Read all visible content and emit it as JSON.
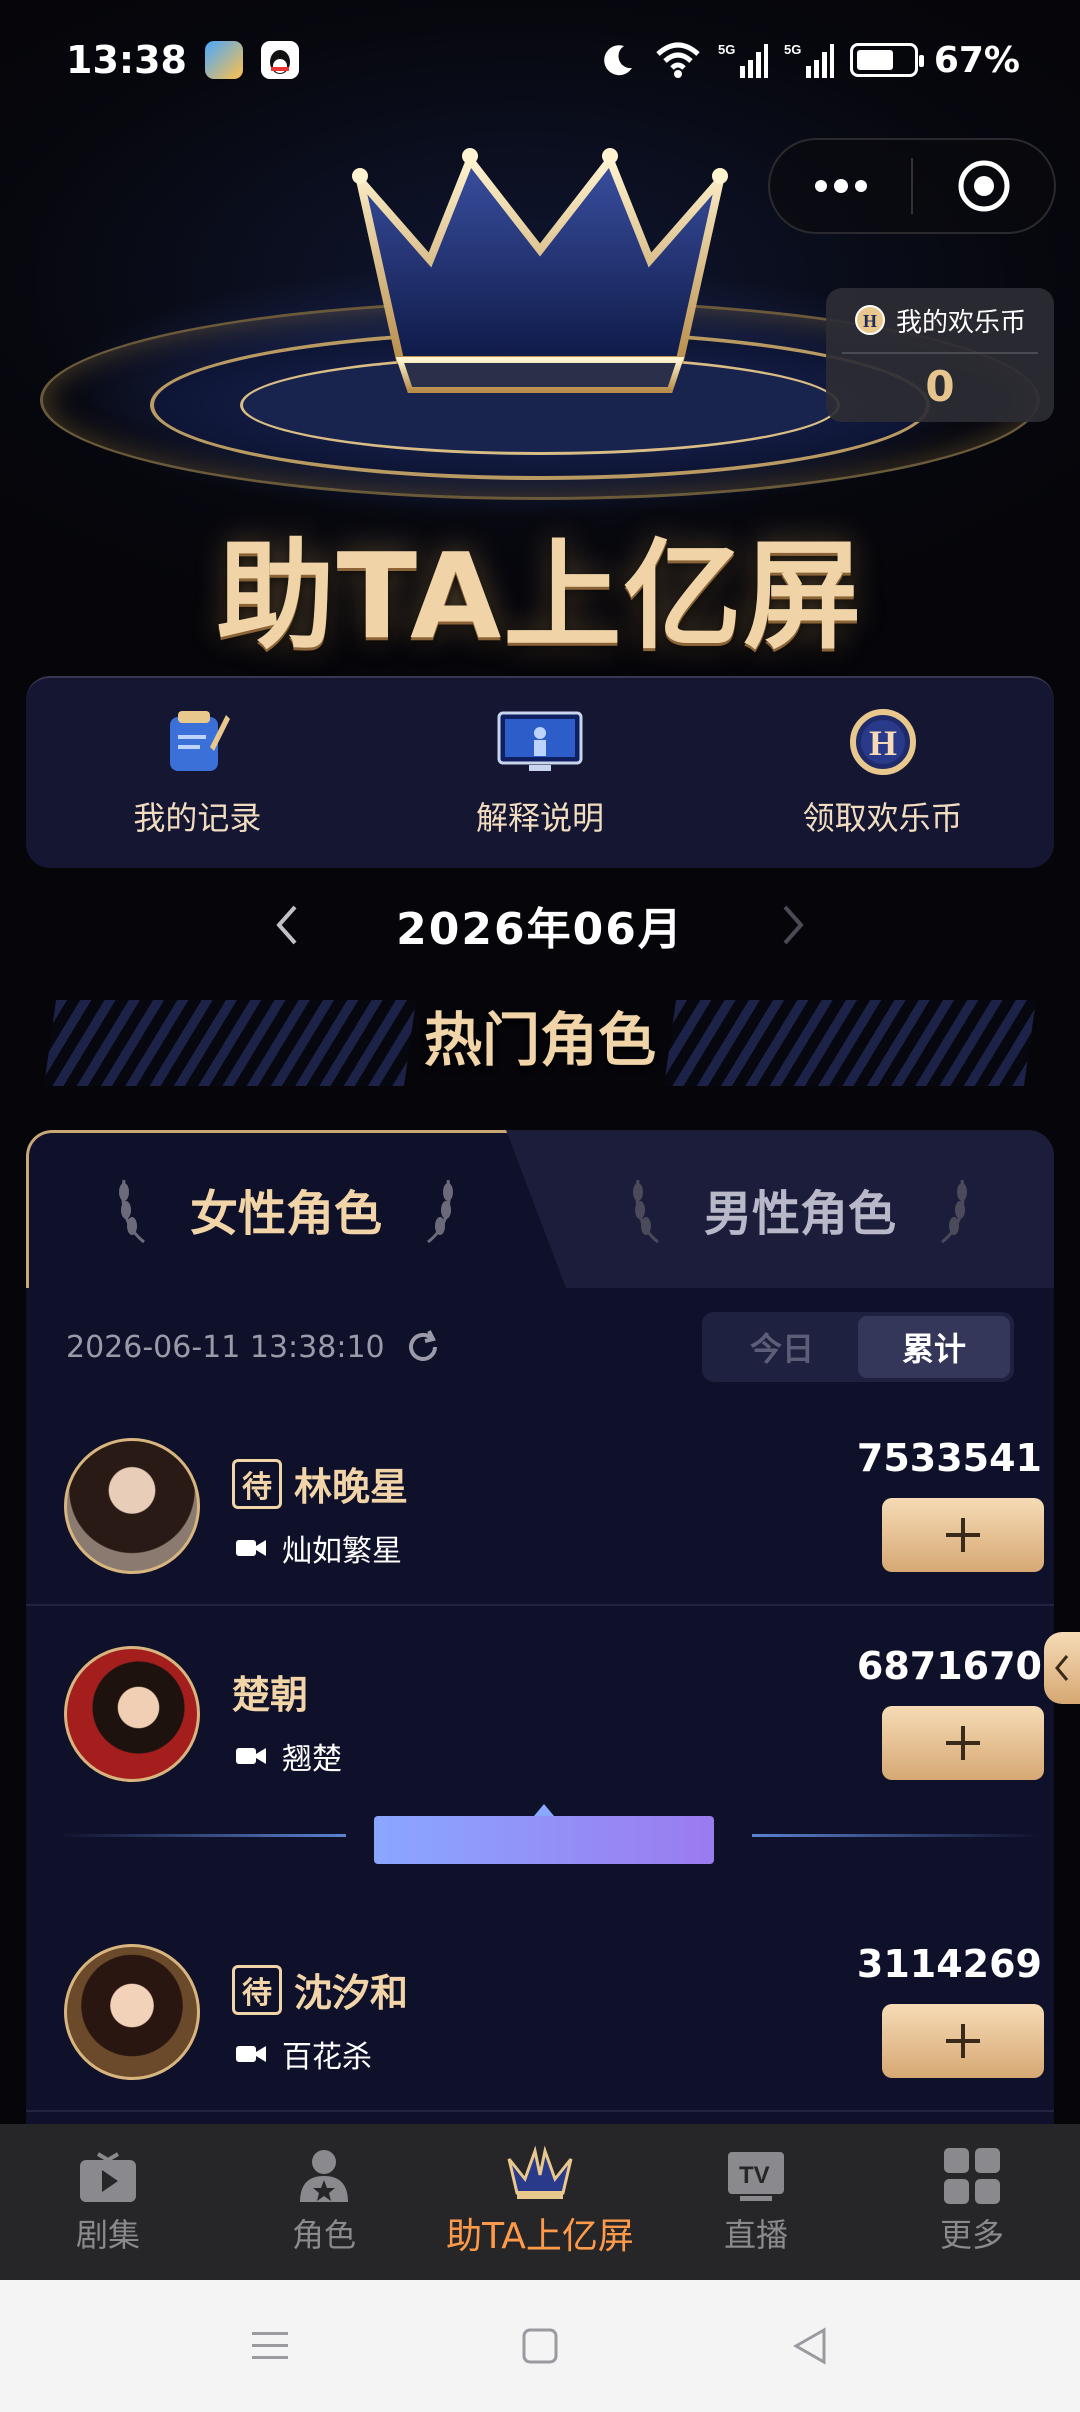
{
  "status_bar": {
    "time": "13:38",
    "network": "5G",
    "battery": "67%",
    "battery_level": 0.67
  },
  "hero": {
    "title": "助TA上亿屏"
  },
  "coin_box": {
    "label": "我的欢乐币",
    "value": "0"
  },
  "shortcuts": [
    {
      "label": "我的记录",
      "icon": "record-icon"
    },
    {
      "label": "解释说明",
      "icon": "monitor-icon"
    },
    {
      "label": "领取欢乐币",
      "icon": "coin-icon"
    }
  ],
  "month": {
    "label": "2026年06月"
  },
  "section": {
    "title": "热门角色"
  },
  "tabs": {
    "female": "女性角色",
    "male": "男性角色",
    "active": "female"
  },
  "list_header": {
    "timestamp": "2026-06-11 13:38:10",
    "segment_today": "今日",
    "segment_total": "累计",
    "active_segment": "累计"
  },
  "roles": [
    {
      "badge": "待",
      "name": "林晚星",
      "drama": "灿如繁星",
      "score": "7533541"
    },
    {
      "badge": "",
      "name": "楚朝",
      "drama": "翘楚",
      "score": "6871670"
    },
    {
      "badge": "待",
      "name": "沈汐和",
      "drama": "百花杀",
      "score": "3114269"
    }
  ],
  "bottom_nav": [
    {
      "label": "剧集",
      "icon": "play-icon"
    },
    {
      "label": "角色",
      "icon": "person-star-icon"
    },
    {
      "label": "助TA上亿屏",
      "icon": "crown-icon"
    },
    {
      "label": "直播",
      "icon": "tv-icon"
    },
    {
      "label": "更多",
      "icon": "grid-icon"
    }
  ],
  "colors": {
    "accent_gold": "#f1d4a7",
    "active_nav": "#ff9a4a",
    "panel": "#0f102a"
  }
}
